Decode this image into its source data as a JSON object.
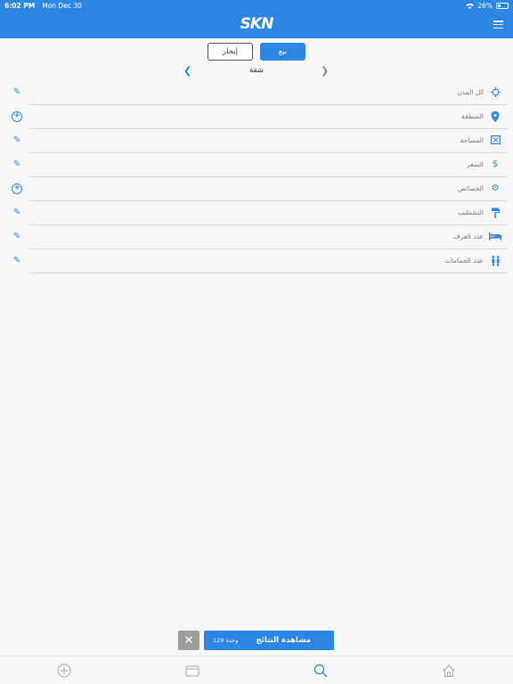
{
  "status_bar": {
    "time": "6:02 PM",
    "date": "Mon Dec 30",
    "wifi_icon": "wifi-icon",
    "battery": "26%"
  },
  "header": {
    "logo": "SKN",
    "menu_icon": "hamburger-menu-icon"
  },
  "deal_type": {
    "rent_label": "إيجار",
    "sale_label": "بيع",
    "selected": "بيع"
  },
  "property_type": {
    "label": "شقة"
  },
  "filters": [
    {
      "label": "كل المدن",
      "icon": "crosshair-icon",
      "action": "edit"
    },
    {
      "label": "المنطقة",
      "icon": "map-pin-icon",
      "action": "add"
    },
    {
      "label": "المساحة",
      "icon": "area-icon",
      "action": "edit"
    },
    {
      "label": "السعر",
      "icon": "dollar-icon",
      "action": "edit"
    },
    {
      "label": "الخصائص",
      "icon": "gear-icon",
      "action": "add"
    },
    {
      "label": "التشطيب",
      "icon": "paint-roller-icon",
      "action": "edit"
    },
    {
      "label": "عدد الغرف",
      "icon": "bed-icon",
      "action": "edit"
    },
    {
      "label": "عدد الحمامات",
      "icon": "people-icon",
      "action": "edit"
    }
  ],
  "results": {
    "count_text": "129 وحدة",
    "button_label": "مشاهدة النتائج"
  },
  "tabs": [
    {
      "name": "add",
      "icon": "plus-circle-icon"
    },
    {
      "name": "saved",
      "icon": "folder-icon"
    },
    {
      "name": "search",
      "icon": "search-icon"
    },
    {
      "name": "home",
      "icon": "home-icon"
    }
  ],
  "colors": {
    "brand": "#2e86e4",
    "gray_button": "#9e9e9e"
  }
}
